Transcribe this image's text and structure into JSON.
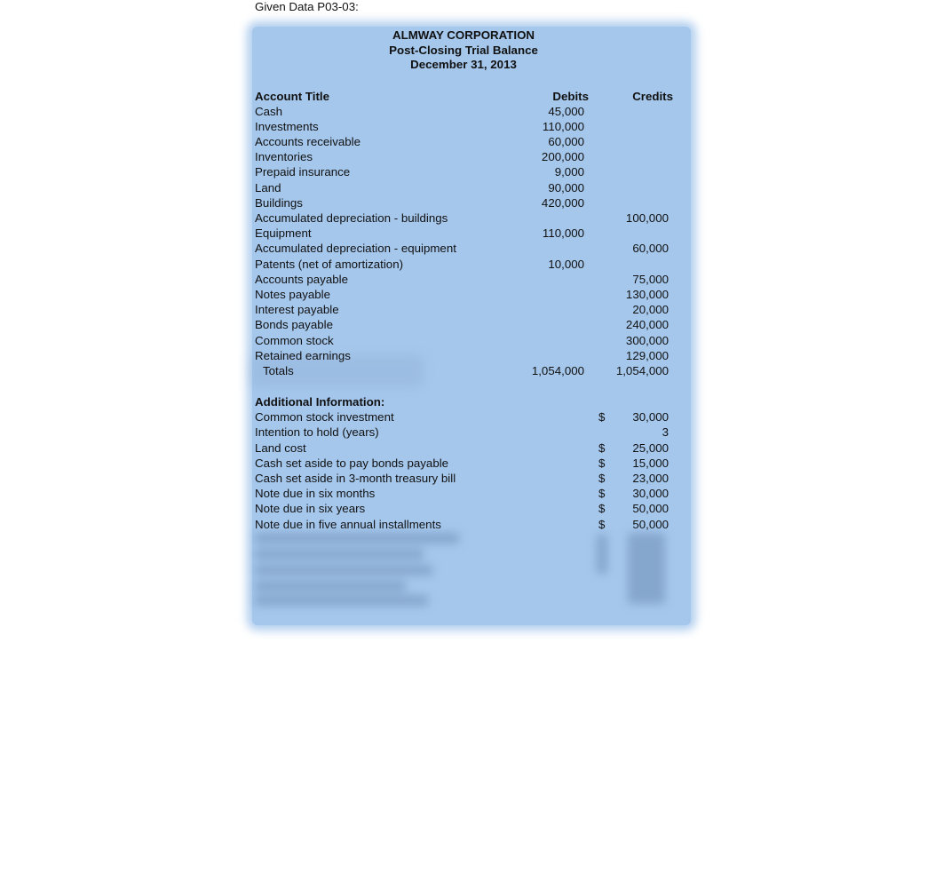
{
  "caption": "Given Data P03-03:",
  "report": {
    "company": "ALMWAY CORPORATION",
    "statement": "Post-Closing Trial Balance",
    "date": "December 31, 2013",
    "headers": {
      "title": "Account Title",
      "debits": "Debits",
      "credits": "Credits"
    },
    "rows": [
      {
        "title": "Cash",
        "debit": "45,000",
        "credit": ""
      },
      {
        "title": "Investments",
        "debit": "110,000",
        "credit": ""
      },
      {
        "title": "Accounts receivable",
        "debit": "60,000",
        "credit": ""
      },
      {
        "title": "Inventories",
        "debit": "200,000",
        "credit": ""
      },
      {
        "title": "Prepaid insurance",
        "debit": "9,000",
        "credit": ""
      },
      {
        "title": "Land",
        "debit": "90,000",
        "credit": ""
      },
      {
        "title": "Buildings",
        "debit": "420,000",
        "credit": ""
      },
      {
        "title": "Accumulated depreciation - buildings",
        "debit": "",
        "credit": "100,000"
      },
      {
        "title": "Equipment",
        "debit": "110,000",
        "credit": ""
      },
      {
        "title": "Accumulated depreciation - equipment",
        "debit": "",
        "credit": "60,000"
      },
      {
        "title": "Patents (net of amortization)",
        "debit": "10,000",
        "credit": ""
      },
      {
        "title": "Accounts payable",
        "debit": "",
        "credit": "75,000"
      },
      {
        "title": "Notes payable",
        "debit": "",
        "credit": "130,000"
      },
      {
        "title": "Interest payable",
        "debit": "",
        "credit": "20,000"
      },
      {
        "title": "Bonds payable",
        "debit": "",
        "credit": "240,000"
      },
      {
        "title": "Common stock",
        "debit": "",
        "credit": "300,000"
      },
      {
        "title": "Retained earnings",
        "debit": "",
        "credit": "129,000"
      }
    ],
    "totals": {
      "label": "Totals",
      "debit": "1,054,000",
      "credit": "1,054,000"
    },
    "additional": {
      "heading": "Additional Information:",
      "items": [
        {
          "label": "Common stock investment",
          "currency": "$",
          "value": "30,000"
        },
        {
          "label": "Intention to hold (years)",
          "currency": "",
          "value": "3"
        },
        {
          "label": "Land cost",
          "currency": "$",
          "value": "25,000"
        },
        {
          "label": "Cash set aside to pay bonds payable",
          "currency": "$",
          "value": "15,000"
        },
        {
          "label": "Cash set aside in 3-month treasury bill",
          "currency": "$",
          "value": "23,000"
        },
        {
          "label": "Note due in six months",
          "currency": "$",
          "value": "30,000"
        },
        {
          "label": "Note due in six years",
          "currency": "$",
          "value": "50,000"
        },
        {
          "label": "Note due in five annual installments",
          "currency": "$",
          "value": "50,000"
        }
      ]
    }
  },
  "colors": {
    "panel": "#a5c7ec"
  }
}
